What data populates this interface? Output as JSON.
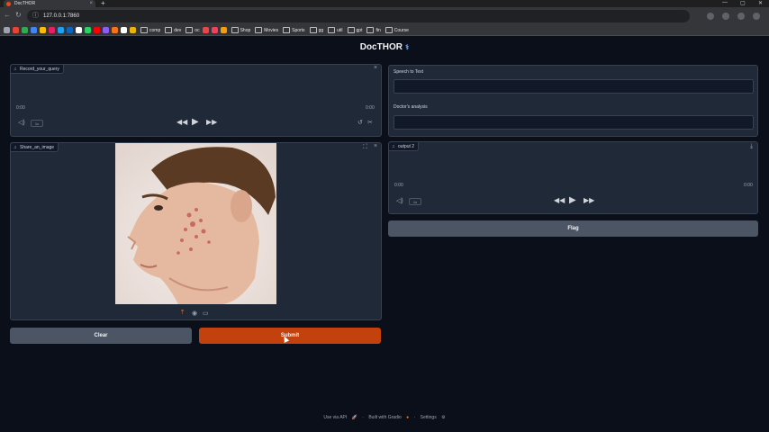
{
  "browser": {
    "tab_title": "DocTHOR",
    "url": "127.0.0.1:7860",
    "bookmark_folders": [
      "comp",
      "dev",
      "oc",
      "Shop",
      "Movies",
      "Sports",
      "gg",
      "util",
      "gpt",
      "fin",
      "Course"
    ]
  },
  "app": {
    "title": "DocTHOR",
    "title_icon": "stethoscope-icon",
    "accent_color": "#c2410c"
  },
  "audio_input": {
    "label": "Record_your_query",
    "time_start": "0:00",
    "time_end": "0:00",
    "speed": "1x"
  },
  "image_input": {
    "label": "Share_an_image"
  },
  "speech_to_text": {
    "label": "Speech to Text",
    "value": ""
  },
  "doctors_analysis": {
    "label": "Doctor's analysis",
    "value": ""
  },
  "audio_output": {
    "label": "output 2",
    "time_start": "0:00",
    "time_end": "0:00",
    "speed": "1x"
  },
  "buttons": {
    "clear": "Clear",
    "submit": "Submit",
    "flag": "Flag"
  },
  "footer": {
    "api": "Use via API",
    "built": "Built with Gradio",
    "settings": "Settings"
  }
}
